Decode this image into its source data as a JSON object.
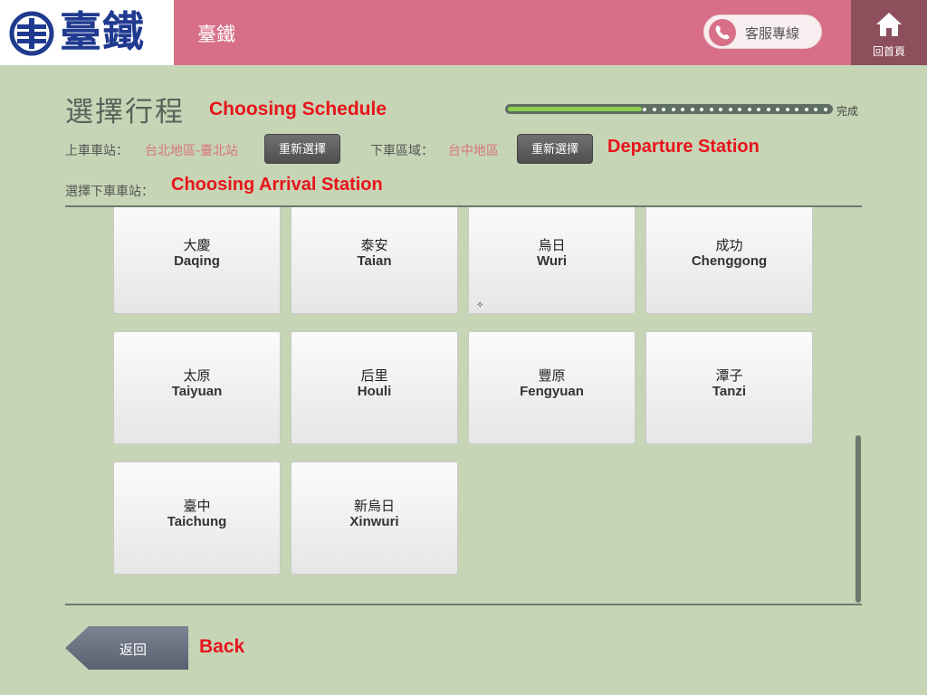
{
  "header": {
    "logo_text": "臺鐵",
    "title": "臺鐵",
    "hotline_label": "客服專線",
    "home_label": "回首頁"
  },
  "page": {
    "title": "選擇行程",
    "progress": {
      "fraction": 0.41,
      "label": "完成"
    }
  },
  "trip": {
    "boarding_label": "上車車站：",
    "boarding_value": "台北地區-臺北站",
    "alighting_region_label": "下車區域：",
    "alighting_region_value": "台中地區",
    "reselect_label": "重新選擇",
    "choose_station_label": "選擇下車車站："
  },
  "annotations": {
    "choosing_schedule": "Choosing Schedule",
    "departure_station": "Departure Station",
    "choosing_arrival": "Choosing Arrival Station",
    "back": "Back"
  },
  "stations": [
    {
      "zh": "大慶",
      "en": "Daqing"
    },
    {
      "zh": "泰安",
      "en": "Taian"
    },
    {
      "zh": "烏日",
      "en": "Wuri"
    },
    {
      "zh": "成功",
      "en": "Chenggong"
    },
    {
      "zh": "太原",
      "en": "Taiyuan"
    },
    {
      "zh": "后里",
      "en": "Houli"
    },
    {
      "zh": "豐原",
      "en": "Fengyuan"
    },
    {
      "zh": "潭子",
      "en": "Tanzi"
    },
    {
      "zh": "臺中",
      "en": "Taichung"
    },
    {
      "zh": "新烏日",
      "en": "Xinwuri"
    }
  ],
  "back_label": "返回",
  "colors": {
    "header_bg": "#d66f87",
    "home_bg": "#8d4f5b",
    "page_bg": "#c6d5b5",
    "logo_blue": "#1f3a8f",
    "annotation_red": "#e8141c",
    "highlight_value": "#d8747f",
    "progress_fill": "#8dcf4a"
  },
  "icons": [
    "railway-emblem-icon",
    "phone-icon",
    "home-icon",
    "back-arrow-icon"
  ]
}
